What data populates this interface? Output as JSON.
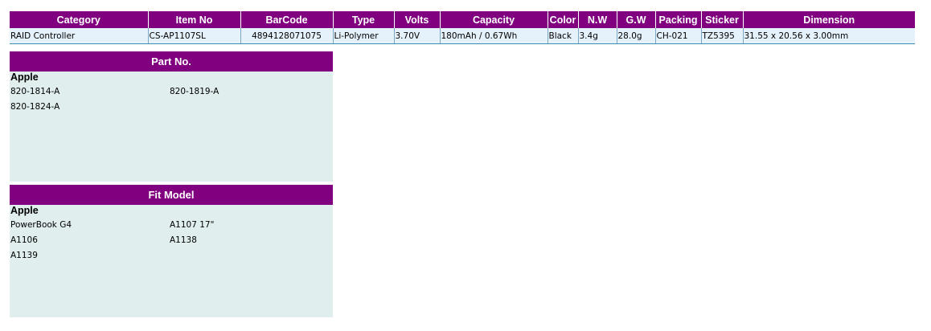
{
  "spec": {
    "headers": [
      "Category",
      "Item No",
      "BarCode",
      "Type",
      "Volts",
      "Capacity",
      "Color",
      "N.W",
      "G.W",
      "Packing",
      "Sticker",
      "Dimension"
    ],
    "row": {
      "category": "RAID Controller",
      "item_no": "CS-AP1107SL",
      "barcode": "4894128071075",
      "type": "Li-Polymer",
      "volts": "3.70V",
      "capacity": "180mAh / 0.67Wh",
      "color": "Black",
      "nw": "3.4g",
      "gw": "28.0g",
      "packing": "CH-021",
      "sticker": "TZ5395",
      "dimension": "31.55 x 20.56 x 3.00mm"
    }
  },
  "part_no": {
    "title": "Part No.",
    "brand": "Apple",
    "items": [
      "820-1814-A",
      "820-1819-A",
      "820-1824-A"
    ]
  },
  "fit_model": {
    "title": "Fit Model",
    "brand": "Apple",
    "items": [
      "PowerBook G4",
      "A1107 17\"",
      "A1106",
      "A1138",
      "A1139"
    ]
  },
  "colors": {
    "header_bg": "#800080",
    "row_bg": "#e6f2fb",
    "panel_bg": "#e0eeee"
  }
}
